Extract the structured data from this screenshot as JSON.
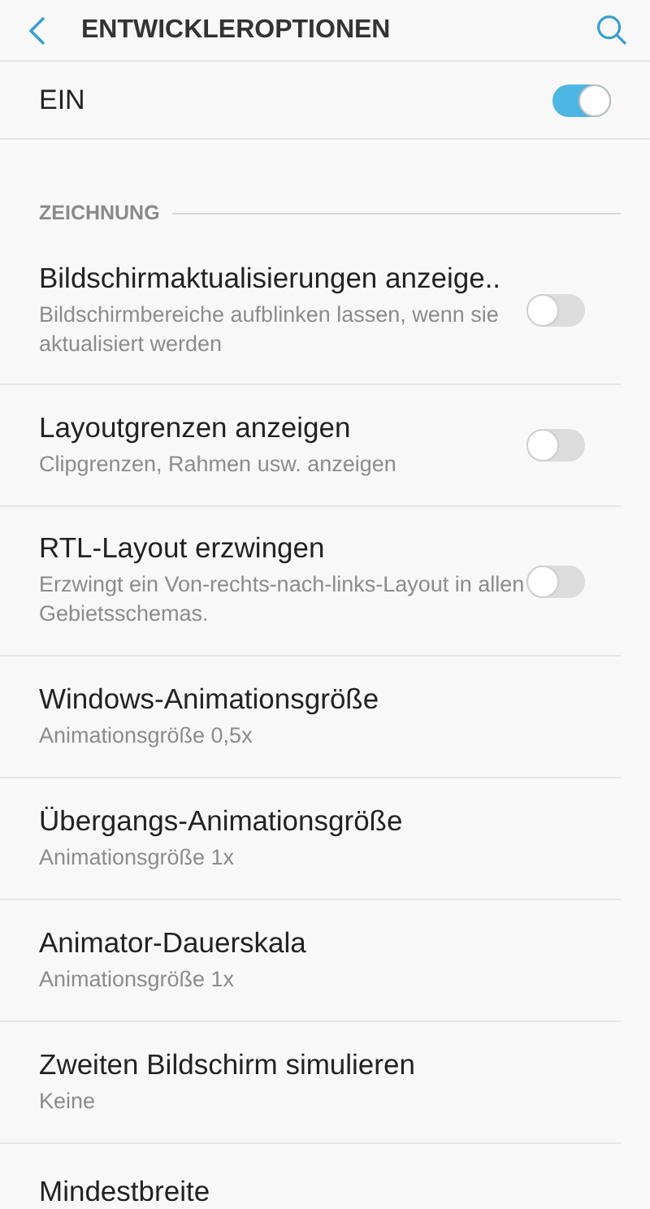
{
  "header": {
    "title": "ENTWICKLEROPTIONEN"
  },
  "master": {
    "label": "EIN",
    "on": true
  },
  "section": {
    "title": "ZEICHNUNG"
  },
  "items": [
    {
      "kind": "toggle",
      "title": "Bildschirmaktualisierungen anzeige..",
      "summary": "Bildschirmbereiche aufblinken lassen, wenn sie aktualisiert werden",
      "on": false
    },
    {
      "kind": "toggle",
      "title": "Layoutgrenzen anzeigen",
      "summary": "Clipgrenzen, Rahmen usw. anzeigen",
      "on": false
    },
    {
      "kind": "toggle",
      "title": "RTL-Layout erzwingen",
      "summary": "Erzwingt ein Von-rechts-nach-links-Layout in allen Gebietsschemas.",
      "on": false
    },
    {
      "kind": "value",
      "title": "Windows-Animationsgröße",
      "summary": "Animationsgröße 0,5x"
    },
    {
      "kind": "value",
      "title": "Übergangs-Animationsgröße",
      "summary": "Animationsgröße 1x"
    },
    {
      "kind": "value",
      "title": "Animator-Dauerskala",
      "summary": "Animationsgröße 1x"
    },
    {
      "kind": "value",
      "title": "Zweiten Bildschirm simulieren",
      "summary": "Keine"
    },
    {
      "kind": "value",
      "title": "Mindestbreite"
    }
  ]
}
